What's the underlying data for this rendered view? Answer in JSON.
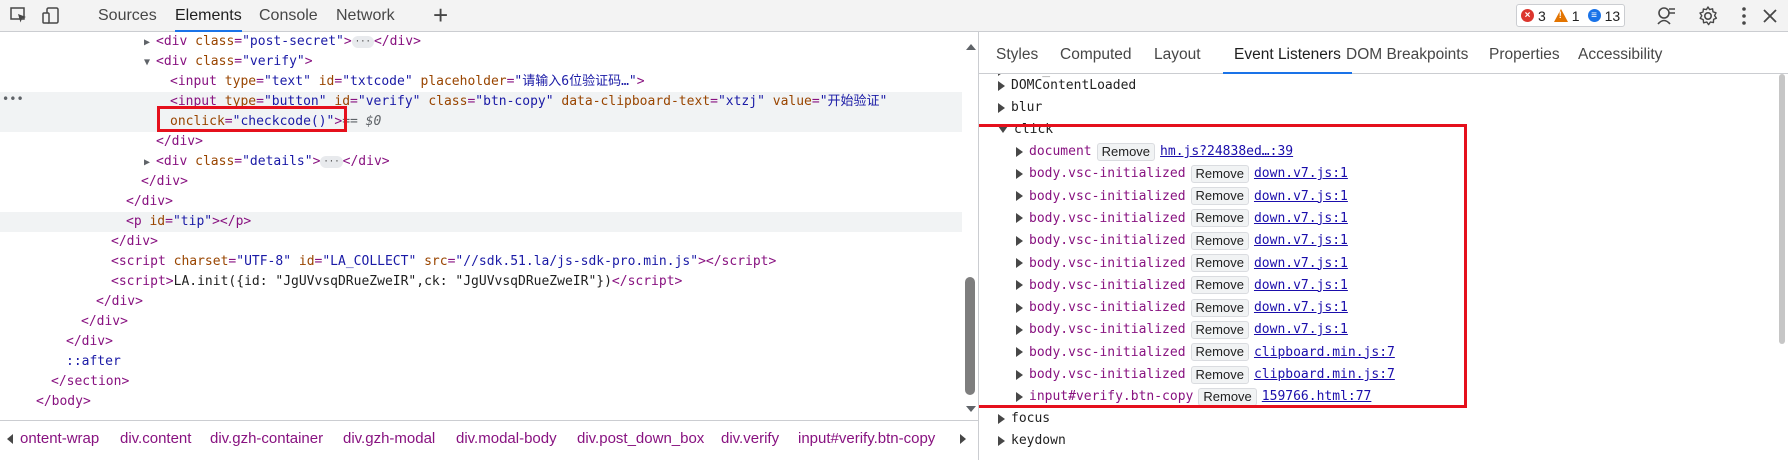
{
  "toolbar": {
    "tabs": [
      "Sources",
      "Elements",
      "Console",
      "Network"
    ],
    "active_tab": "Elements",
    "errors": "3",
    "warnings": "1",
    "messages": "13",
    "icons": [
      "inspect-element-icon",
      "device-toolbar-icon",
      "plus-icon",
      "performance-insights-icon",
      "settings-gear-icon",
      "more-vertical-icon",
      "close-icon"
    ]
  },
  "dom": {
    "post_secret_class": "\"post-secret\"",
    "verify_class": "\"verify\"",
    "input1_type": "\"text\"",
    "input1_id": "\"txtcode\"",
    "input1_placeholder": "\"请输入6位验证码…\"",
    "input2_type": "\"button\"",
    "input2_id": "\"verify\"",
    "input2_class": "\"btn-copy\"",
    "input2_clipboard": "\"xtzj\"",
    "input2_value": "\"开始验证\"",
    "onclick_value": "\"checkcode()\"",
    "selected_marker": "== $0",
    "details_class": "\"details\"",
    "tip_id": "\"tip\"",
    "script_charset": "\"UTF-8\"",
    "script_id": "\"LA_COLLECT\"",
    "script_src": "\"//sdk.51.la/js-sdk-pro.min.js\"",
    "script_inline": "LA.init({id: \"JgUVvsqDRueZweIR\",ck: \"JgUVvsqDRueZweIR\"})",
    "after": "::after"
  },
  "breadcrumbs": [
    "ontent-wrap",
    "div.content",
    "div.gzh-container",
    "div.gzh-modal",
    "div.modal-body",
    "div.post_down_box",
    "div.verify",
    "input#verify.btn-copy"
  ],
  "side_tabs": [
    "Styles",
    "Computed",
    "Layout",
    "Event Listeners",
    "DOM Breakpoints",
    "Properties",
    "Accessibility"
  ],
  "side_active_tab": "Event Listeners",
  "listeners": {
    "partial_top": "DOMContentLoaded",
    "collapsed_before": [
      "DOMContentLoaded",
      "blur"
    ],
    "expanded_event": "click",
    "remove_label": "Remove",
    "entries": [
      {
        "target": "document",
        "source": "hm.js?24838ed…:39"
      },
      {
        "target": "body.vsc-initialized",
        "source": "down.v7.js:1"
      },
      {
        "target": "body.vsc-initialized",
        "source": "down.v7.js:1"
      },
      {
        "target": "body.vsc-initialized",
        "source": "down.v7.js:1"
      },
      {
        "target": "body.vsc-initialized",
        "source": "down.v7.js:1"
      },
      {
        "target": "body.vsc-initialized",
        "source": "down.v7.js:1"
      },
      {
        "target": "body.vsc-initialized",
        "source": "down.v7.js:1"
      },
      {
        "target": "body.vsc-initialized",
        "source": "down.v7.js:1"
      },
      {
        "target": "body.vsc-initialized",
        "source": "down.v7.js:1"
      },
      {
        "target": "body.vsc-initialized",
        "source": "clipboard.min.js:7"
      },
      {
        "target": "body.vsc-initialized",
        "source": "clipboard.min.js:7"
      },
      {
        "target": "input#verify.btn-copy",
        "source": "159766.html:77"
      }
    ],
    "collapsed_after": [
      "focus",
      "keydown"
    ]
  },
  "colors": {
    "accent": "#1a73e8",
    "highlight_box": "#e5101c",
    "tag": "#881280",
    "attr_name": "#994500",
    "attr_value": "#1a1aa6"
  }
}
